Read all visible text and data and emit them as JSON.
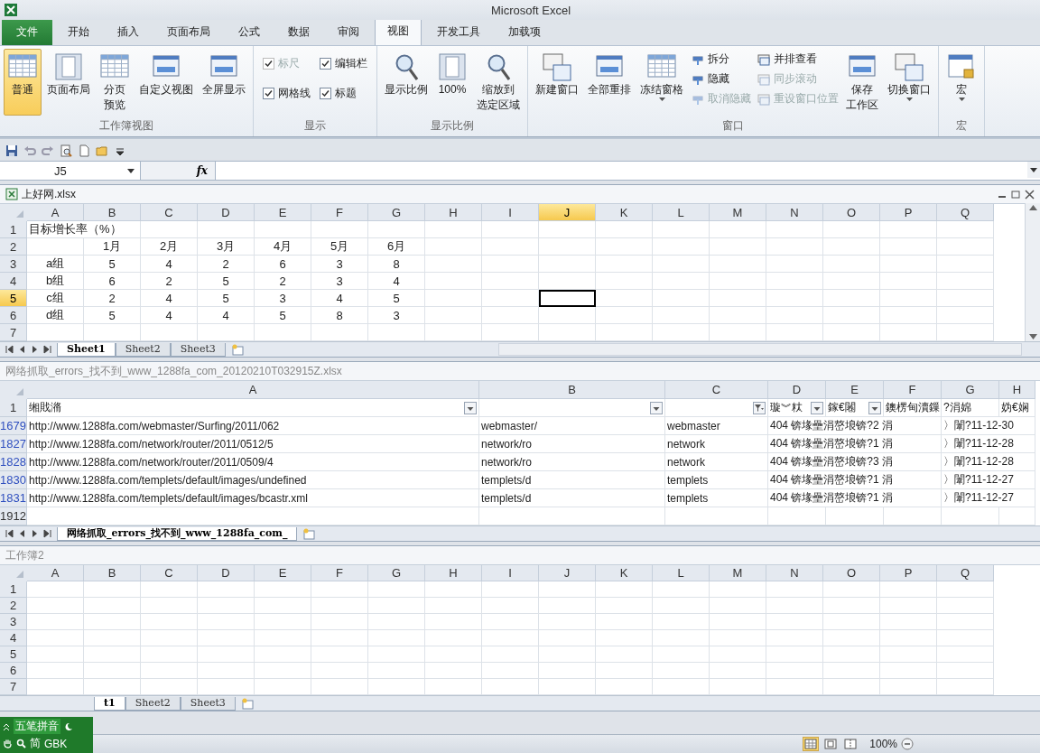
{
  "window": {
    "title": "Microsoft Excel"
  },
  "ribbon_tabs": [
    {
      "label": "文件",
      "kind": "file",
      "selected": false
    },
    {
      "label": "开始",
      "kind": "tab",
      "selected": false
    },
    {
      "label": "插入",
      "kind": "tab",
      "selected": false
    },
    {
      "label": "页面布局",
      "kind": "tab",
      "selected": false
    },
    {
      "label": "公式",
      "kind": "tab",
      "selected": false
    },
    {
      "label": "数据",
      "kind": "tab",
      "selected": false
    },
    {
      "label": "审阅",
      "kind": "tab",
      "selected": false
    },
    {
      "label": "视图",
      "kind": "tab",
      "selected": true
    },
    {
      "label": "开发工具",
      "kind": "tab",
      "selected": false
    },
    {
      "label": "加载项",
      "kind": "tab",
      "selected": false
    }
  ],
  "ribbon_groups": [
    {
      "label": "工作簿视图",
      "items": [
        {
          "kind": "large",
          "label": "普通",
          "selected": true,
          "dropdown": false
        },
        {
          "kind": "large",
          "label": "页面布局",
          "selected": false,
          "dropdown": false
        },
        {
          "kind": "large",
          "label": [
            "分页",
            "预览"
          ],
          "selected": false,
          "dropdown": false
        },
        {
          "kind": "large",
          "label": "自定义视图",
          "selected": false,
          "dropdown": false
        },
        {
          "kind": "large",
          "label": "全屏显示",
          "selected": false,
          "dropdown": false
        }
      ]
    },
    {
      "label": "显示",
      "items": [
        {
          "kind": "check",
          "label": "标尺",
          "checked": true,
          "disabled": true
        },
        {
          "kind": "check",
          "label": "编辑栏",
          "checked": true,
          "disabled": false
        },
        {
          "kind": "check",
          "label": "网格线",
          "checked": true,
          "disabled": false
        },
        {
          "kind": "check",
          "label": "标题",
          "checked": true,
          "disabled": false
        }
      ]
    },
    {
      "label": "显示比例",
      "items": [
        {
          "kind": "large",
          "label": "显示比例",
          "selected": false,
          "dropdown": false
        },
        {
          "kind": "large",
          "label": "100%",
          "selected": false,
          "dropdown": false
        },
        {
          "kind": "large",
          "label": [
            "缩放到",
            "选定区域"
          ],
          "selected": false,
          "dropdown": false
        }
      ]
    },
    {
      "label": "窗口",
      "items": [
        {
          "kind": "large",
          "label": "新建窗口",
          "selected": false,
          "dropdown": false
        },
        {
          "kind": "large",
          "label": "全部重排",
          "selected": false,
          "dropdown": false
        },
        {
          "kind": "large",
          "label": "冻结窗格",
          "selected": false,
          "dropdown": true
        },
        {
          "kind": "small",
          "label": "拆分",
          "disabled": false
        },
        {
          "kind": "small",
          "label": "隐藏",
          "disabled": false
        },
        {
          "kind": "small",
          "label": "取消隐藏",
          "disabled": true
        },
        {
          "kind": "small",
          "label": "并排查看",
          "disabled": false
        },
        {
          "kind": "small",
          "label": "同步滚动",
          "disabled": true
        },
        {
          "kind": "small",
          "label": "重设窗口位置",
          "disabled": true
        },
        {
          "kind": "large",
          "label": [
            "保存",
            "工作区"
          ],
          "selected": false,
          "dropdown": false
        },
        {
          "kind": "large",
          "label": "切换窗口",
          "selected": false,
          "dropdown": true
        }
      ]
    },
    {
      "label": "宏",
      "items": [
        {
          "kind": "large",
          "label": "宏",
          "selected": false,
          "dropdown": true
        }
      ]
    }
  ],
  "formula_bar": {
    "name_box": "J5",
    "fx_label": "fx"
  },
  "workbooks": [
    {
      "title": "上好网.xlsx",
      "kind": "report",
      "active": true,
      "scrollbars": true,
      "columns": [
        {
          "label": "A",
          "selected": false
        },
        {
          "label": "B",
          "selected": false
        },
        {
          "label": "C",
          "selected": false
        },
        {
          "label": "D",
          "selected": false
        },
        {
          "label": "E",
          "selected": false
        },
        {
          "label": "F",
          "selected": false
        },
        {
          "label": "G",
          "selected": false
        },
        {
          "label": "H",
          "selected": false
        },
        {
          "label": "I",
          "selected": false
        },
        {
          "label": "J",
          "selected": true
        },
        {
          "label": "K",
          "selected": false
        },
        {
          "label": "L",
          "selected": false
        },
        {
          "label": "M",
          "selected": false
        },
        {
          "label": "N",
          "selected": false
        },
        {
          "label": "O",
          "selected": false
        },
        {
          "label": "P",
          "selected": false
        },
        {
          "label": "Q",
          "selected": false
        }
      ],
      "rows": [
        {
          "header": "1",
          "selected": false,
          "cells": [
            "目标增长率（%）",
            null
          ]
        },
        {
          "header": "2",
          "selected": false,
          "cells": [
            null,
            "1月",
            "2月",
            "3月",
            "4月",
            "5月",
            "6月"
          ]
        },
        {
          "header": "3",
          "selected": false,
          "cells": [
            "a组",
            "5",
            "4",
            "2",
            "6",
            "3",
            "8"
          ]
        },
        {
          "header": "4",
          "selected": false,
          "cells": [
            "b组",
            "6",
            "2",
            "5",
            "2",
            "3",
            "4"
          ]
        },
        {
          "header": "5",
          "selected": true,
          "cells": [
            "c组",
            "2",
            "4",
            "5",
            "3",
            "4",
            "5"
          ]
        },
        {
          "header": "6",
          "selected": false,
          "cells": [
            "d组",
            "5",
            "4",
            "4",
            "5",
            "8",
            "3"
          ]
        },
        {
          "header": "7",
          "selected": false,
          "cells": []
        }
      ],
      "sheet_tabs": [
        {
          "label": "Sheet1",
          "selected": true
        },
        {
          "label": "Sheet2",
          "selected": false
        },
        {
          "label": "Sheet3",
          "selected": false
        }
      ]
    },
    {
      "title": "网络抓取_errors_找不到_www_1288fa_com_20120210T032915Z.xlsx",
      "kind": "list",
      "active": false,
      "scrollbars": false,
      "columns": [
        {
          "label": "A",
          "selected": false
        },
        {
          "label": "B",
          "selected": false
        },
        {
          "label": "C",
          "selected": false
        },
        {
          "label": "D",
          "selected": false
        },
        {
          "label": "E",
          "selected": false
        },
        {
          "label": "F",
          "selected": false
        },
        {
          "label": "G",
          "selected": false
        },
        {
          "label": "H",
          "selected": false
        }
      ],
      "rows": [
        {
          "header": "1",
          "filtered": false,
          "cells": [
            {
              "text": "缃戝潃",
              "filtered": false
            },
            {
              "filtered": false
            },
            {
              "filtered": true
            },
            {
              "text": "璇︾粏",
              "filtered": false
            },
            {
              "text": "鎵€闂",
              "filtered": false
            },
            "鐭楞甸瀆鏁",
            "?涓婂",
            "妫€娴"
          ]
        },
        {
          "header": "1679",
          "filtered": true,
          "cells": [
            "http://www.1288fa.com/webmaster/Surfing/2011/062",
            "webmaster/",
            "webmaster",
            "404 锛堟壘涓嶅埌锛?2 涓",
            null,
            null,
            "〉闈?11-12-30",
            null
          ]
        },
        {
          "header": "1827",
          "filtered": true,
          "cells": [
            "http://www.1288fa.com/network/router/2011/0512/5",
            "network/ro",
            "network",
            "404 锛堟壘涓嶅埌锛?1 涓",
            null,
            null,
            "〉闈?11-12-28",
            null
          ]
        },
        {
          "header": "1828",
          "filtered": true,
          "cells": [
            "http://www.1288fa.com/network/router/2011/0509/4",
            "network/ro",
            "network",
            "404 锛堟壘涓嶅埌锛?3 涓",
            null,
            null,
            "〉闈?11-12-28",
            null
          ]
        },
        {
          "header": "1830",
          "filtered": true,
          "cells": [
            "http://www.1288fa.com/templets/default/images/undefined",
            "templets/d",
            "templets",
            "404 锛堟壘涓嶅埌锛?1 涓",
            null,
            null,
            "〉闈?11-12-27",
            null
          ]
        },
        {
          "header": "1831",
          "filtered": true,
          "cells": [
            "http://www.1288fa.com/templets/default/images/bcastr.xml",
            "templets/d",
            "templets",
            "404 锛堟壘涓嶅埌锛?1 涓",
            null,
            null,
            "〉闈?11-12-27",
            null
          ]
        },
        {
          "header": "1912",
          "filtered": false,
          "cells": []
        }
      ],
      "sheet_tabs": [
        {
          "label": "网络抓取_errors_找不到_www_1288fa_com_",
          "selected": true
        }
      ]
    },
    {
      "title": "工作簿2",
      "kind": "blank",
      "active": false,
      "scrollbars": false,
      "columns": [
        {
          "label": "A",
          "selected": false
        },
        {
          "label": "B",
          "selected": false
        },
        {
          "label": "C",
          "selected": false
        },
        {
          "label": "D",
          "selected": false
        },
        {
          "label": "E",
          "selected": false
        },
        {
          "label": "F",
          "selected": false
        },
        {
          "label": "G",
          "selected": false
        },
        {
          "label": "H",
          "selected": false
        },
        {
          "label": "I",
          "selected": false
        },
        {
          "label": "J",
          "selected": false
        },
        {
          "label": "K",
          "selected": false
        },
        {
          "label": "L",
          "selected": false
        },
        {
          "label": "M",
          "selected": false
        },
        {
          "label": "N",
          "selected": false
        },
        {
          "label": "O",
          "selected": false
        },
        {
          "label": "P",
          "selected": false
        },
        {
          "label": "Q",
          "selected": false
        }
      ],
      "rows": [
        {
          "header": "1",
          "selected": false,
          "cells": []
        },
        {
          "header": "2",
          "selected": false,
          "cells": []
        },
        {
          "header": "3",
          "selected": false,
          "cells": []
        },
        {
          "header": "4",
          "selected": false,
          "cells": []
        },
        {
          "header": "5",
          "selected": false,
          "cells": []
        },
        {
          "header": "6",
          "selected": false,
          "cells": []
        },
        {
          "header": "7",
          "selected": false,
          "cells": []
        }
      ],
      "sheet_tabs": [
        {
          "label": "t1",
          "selected": true
        },
        {
          "label": "Sheet2",
          "selected": false
        },
        {
          "label": "Sheet3",
          "selected": false
        }
      ]
    }
  ],
  "status_bar": {
    "views": [
      {
        "selected": true
      },
      {
        "selected": false
      },
      {
        "selected": false
      }
    ],
    "zoom": "100%"
  },
  "ime_bar": {
    "name": "五笔拼音",
    "mode": "简",
    "charset": "GBK"
  }
}
